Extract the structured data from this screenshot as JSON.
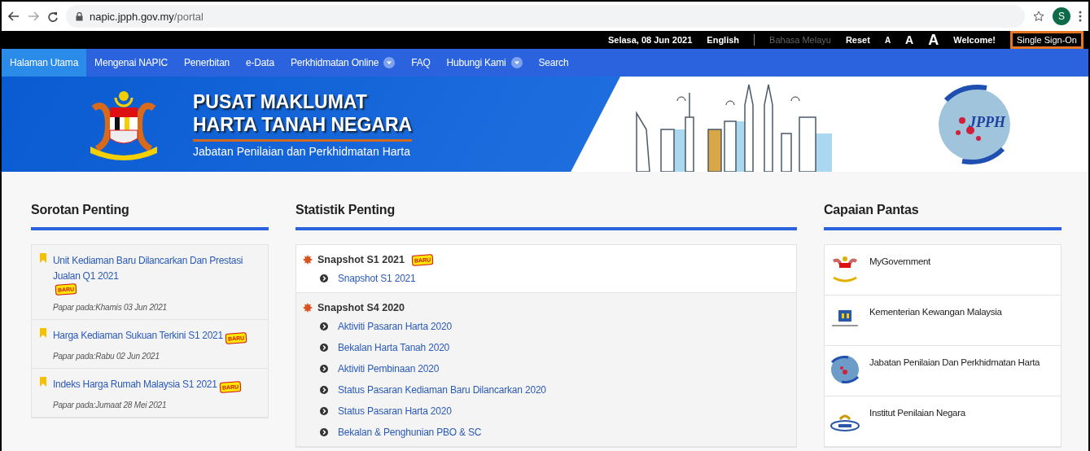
{
  "browser": {
    "url_host": "napic.jpph.gov.my",
    "url_path": "/portal",
    "profile_initial": "S"
  },
  "top_bar": {
    "date": "Selasa, 08 Jun 2021",
    "languages": [
      {
        "label": "English",
        "selected": true
      },
      {
        "label": "Bahasa Melayu",
        "selected": false
      }
    ],
    "reset": "Reset",
    "font_sizes": [
      {
        "label": "A",
        "kind": "small"
      },
      {
        "label": "A",
        "kind": "medium"
      },
      {
        "label": "A",
        "kind": "large"
      }
    ],
    "welcome": "Welcome!",
    "sso": {
      "label": "Single Sign-On",
      "highlighted": true
    }
  },
  "nav": [
    {
      "label": "Halaman Utama",
      "selected": true,
      "dropdown": false
    },
    {
      "label": "Mengenai NAPIC",
      "selected": false,
      "dropdown": false
    },
    {
      "label": "Penerbitan",
      "selected": false,
      "dropdown": false
    },
    {
      "label": "e-Data",
      "selected": false,
      "dropdown": false
    },
    {
      "label": "Perkhidmatan Online",
      "selected": false,
      "dropdown": true
    },
    {
      "label": "FAQ",
      "selected": false,
      "dropdown": false
    },
    {
      "label": "Hubungi Kami",
      "selected": false,
      "dropdown": true
    },
    {
      "label": "Search",
      "selected": false,
      "dropdown": false
    }
  ],
  "banner": {
    "title_lines": [
      "PUSAT MAKLUMAT",
      "HARTA TANAH NEGARA"
    ],
    "subtitle": "Jabatan Penilaian dan Perkhidmatan Harta",
    "logo_text": "JPPH"
  },
  "sorotan": {
    "heading": "Sorotan Penting",
    "items": [
      {
        "title": "Unit Kediaman Baru Dilancarkan Dan Prestasi Jualan Q1 2021",
        "badge": "BARU",
        "date": "Papar pada:Khamis 03 Jun 2021"
      },
      {
        "title": "Harga Kediaman Sukuan Terkini S1 2021",
        "badge": "BARU",
        "date": "Papar pada:Rabu 02 Jun 2021"
      },
      {
        "title": "Indeks Harga Rumah Malaysia S1 2021",
        "badge": "BARU",
        "date": "Papar pada:Jumaat 28 Mei 2021"
      }
    ]
  },
  "statistik": {
    "heading": "Statistik Penting",
    "groups": [
      {
        "title": "Snapshot S1 2021",
        "badge": "BARU",
        "links": [
          "Snapshot S1 2021"
        ]
      },
      {
        "title": "Snapshot S4 2020",
        "links": [
          "Aktiviti Pasaran Harta 2020",
          "Bekalan Harta Tanah 2020",
          "Aktiviti Pembinaan 2020",
          "Status Pasaran Kediaman Baru Dilancarkan 2020",
          "Status Pasaran Harta 2020",
          "Bekalan & Penghunian PBO & SC"
        ]
      }
    ]
  },
  "capaian": {
    "heading": "Capaian Pantas",
    "items": [
      {
        "label": "MyGovernment",
        "kind": "crest"
      },
      {
        "label": "Kementerian Kewangan Malaysia",
        "kind": "ministry"
      },
      {
        "label": "Jabatan Penilaian Dan Perkhidmatan Harta",
        "kind": "globe"
      },
      {
        "label": "Institut Penilaian Negara",
        "kind": "oval"
      }
    ]
  }
}
